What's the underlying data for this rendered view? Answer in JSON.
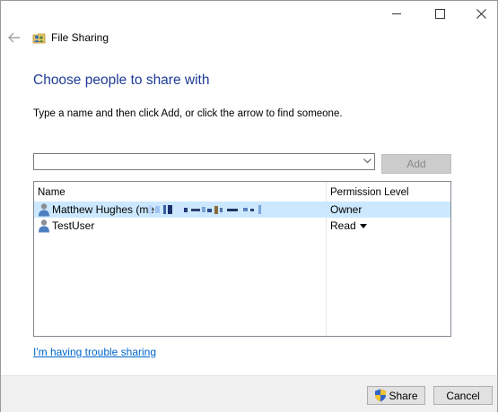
{
  "window": {
    "title": "File Sharing",
    "caption_buttons": [
      "minimize-icon",
      "maximize-icon",
      "close-icon"
    ]
  },
  "heading": "Choose people to share with",
  "instructions": "Type a name and then click Add, or click the arrow to find someone.",
  "name_input": {
    "value": "",
    "placeholder": ""
  },
  "add_button": {
    "label": "Add",
    "enabled": false
  },
  "list": {
    "columns": [
      "Name",
      "Permission Level"
    ],
    "rows": [
      {
        "name": "Matthew Hughes (me",
        "permission": "Owner",
        "selected": true,
        "icon": "user-icon"
      },
      {
        "name": "TestUser",
        "permission": "Read",
        "selected": false,
        "icon": "user-icon"
      }
    ]
  },
  "trouble_link": "I'm having trouble sharing",
  "footer": {
    "share_label": "Share",
    "cancel_label": "Cancel"
  },
  "colors": {
    "heading": "#1e3c96",
    "link": "#0066cc",
    "selected_row": "#cce8ff",
    "footer_bg": "#f0f0f0"
  }
}
